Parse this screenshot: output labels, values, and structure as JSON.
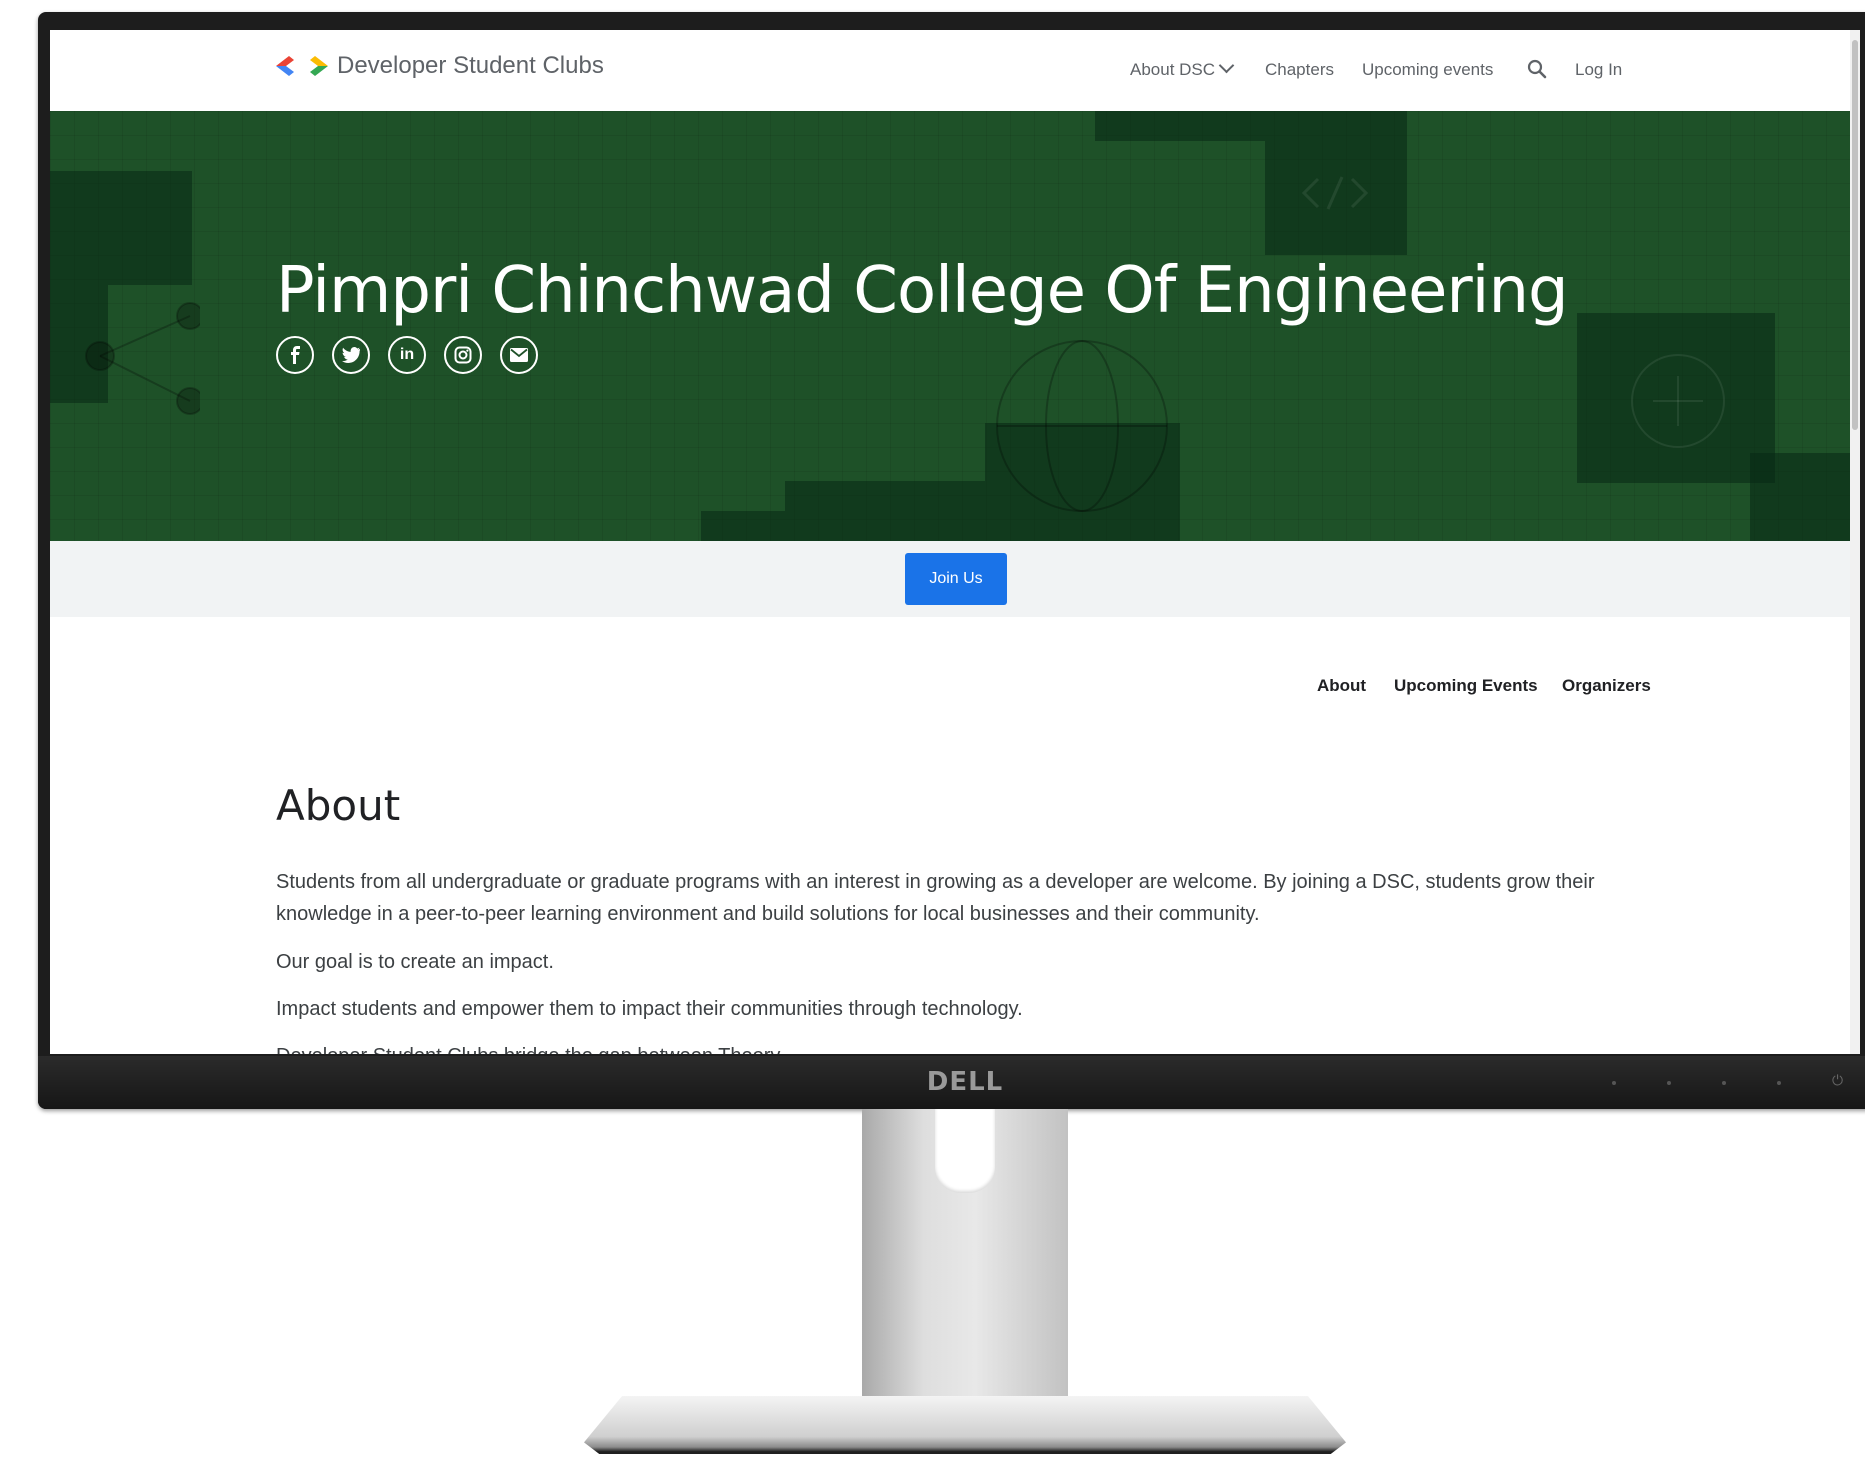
{
  "monitor": {
    "brand": "DELL"
  },
  "header": {
    "logo_text": "Developer Student Clubs",
    "nav": {
      "about": "About DSC",
      "chapters": "Chapters",
      "upcoming": "Upcoming events",
      "login": "Log In"
    }
  },
  "hero": {
    "title": "Pimpri Chinchwad College Of Engineering",
    "social_icons": [
      "facebook-icon",
      "twitter-icon",
      "linkedin-icon",
      "instagram-icon",
      "email-icon"
    ],
    "background_color": "#1e5128"
  },
  "join": {
    "label": "Join Us",
    "color": "#1a73e8"
  },
  "subnav": {
    "about": "About",
    "events": "Upcoming Events",
    "organizers": "Organizers"
  },
  "about": {
    "heading": "About",
    "p1": "Students from all undergraduate or graduate programs with an interest in growing as a developer are welcome. By joining a DSC, students grow their knowledge in a peer-to-peer learning environment and build solutions for local businesses and their community.",
    "p2": "Our goal is to create an impact.",
    "p3": "Impact students and empower them to impact their communities through technology.",
    "p4": "Developer Student Clubs bridge the gap between Theory"
  }
}
